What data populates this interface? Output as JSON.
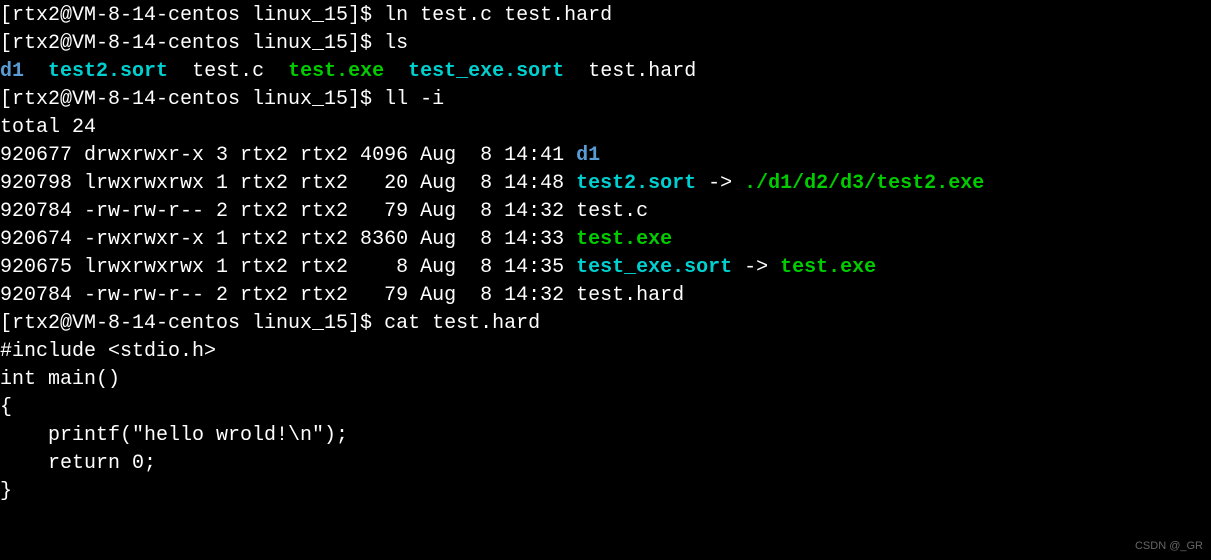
{
  "prompt": "[rtx2@VM-8-14-centos linux_15]$ ",
  "commands": {
    "cmd1": "ln test.c test.hard",
    "cmd2": "ls",
    "cmd3": "ll -i",
    "cmd4": "cat test.hard"
  },
  "ls_output": {
    "d1": "d1",
    "test2_sort": "test2.sort",
    "test_c": "test.c",
    "test_exe": "test.exe",
    "test_exe_sort": "test_exe.sort",
    "test_hard": "test.hard"
  },
  "ll_header": "total 24",
  "ll_rows": {
    "r1_inode": "920677 ",
    "r1_perms": "drwxrwxr-x 3 rtx2 rtx2 4096 Aug  8 14:41 ",
    "r1_name": "d1",
    "r2_inode": "920798 ",
    "r2_perms": "lrwxrwxrwx 1 rtx2 rtx2   20 Aug  8 14:48 ",
    "r2_name": "test2.sort",
    "r2_arrow": " -> ",
    "r2_target": "./d1/d2/d3/test2.exe",
    "r3_inode": "920784 ",
    "r3_perms": "-rw-rw-r-- 2 rtx2 rtx2   79 Aug  8 14:32 ",
    "r3_name": "test.c",
    "r4_inode": "920674 ",
    "r4_perms": "-rwxrwxr-x 1 rtx2 rtx2 8360 Aug  8 14:33 ",
    "r4_name": "test.exe",
    "r5_inode": "920675 ",
    "r5_perms": "lrwxrwxrwx 1 rtx2 rtx2    8 Aug  8 14:35 ",
    "r5_name": "test_exe.sort",
    "r5_arrow": " -> ",
    "r5_target": "test.exe",
    "r6_inode": "920784 ",
    "r6_perms": "-rw-rw-r-- 2 rtx2 rtx2   79 Aug  8 14:32 ",
    "r6_name": "test.hard"
  },
  "cat_output": {
    "l1": "#include <stdio.h>",
    "l2": "int main()",
    "l3": "{",
    "l4": "    printf(\"hello wrold!\\n\");",
    "l5": "",
    "l6": "    return 0;",
    "l7": "}"
  },
  "watermark": "CSDN @_GR"
}
